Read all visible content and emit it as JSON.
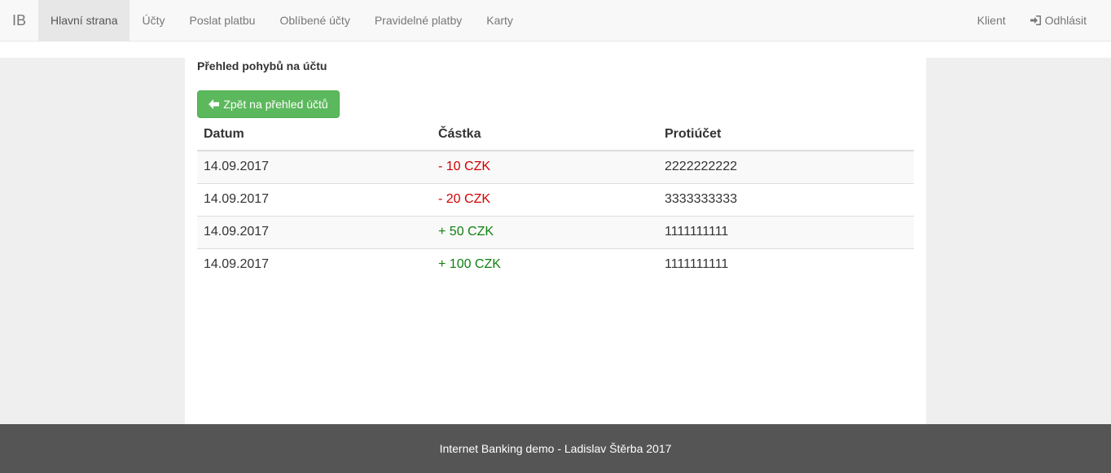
{
  "navbar": {
    "brand": "IB",
    "items": [
      {
        "label": "Hlavní strana",
        "active": true
      },
      {
        "label": "Účty"
      },
      {
        "label": "Poslat platbu"
      },
      {
        "label": "Oblíbené účty"
      },
      {
        "label": "Pravidelné platby"
      },
      {
        "label": "Karty"
      }
    ],
    "right": {
      "client": "Klient",
      "logout": "Odhlásit",
      "logout_icon": "log-in-icon"
    }
  },
  "main": {
    "heading": "Přehled pohybů na účtu",
    "back_button": "Zpět na přehled účtů",
    "back_icon": "arrow-left-icon",
    "table": {
      "headers": [
        "Datum",
        "Částka",
        "Protiúčet"
      ],
      "rows": [
        {
          "date": "14.09.2017",
          "amount": "- 10 CZK",
          "account": "2222222222",
          "direction": "out"
        },
        {
          "date": "14.09.2017",
          "amount": "- 20 CZK",
          "account": "3333333333",
          "direction": "out"
        },
        {
          "date": "14.09.2017",
          "amount": "+ 50 CZK",
          "account": "1111111111",
          "direction": "in"
        },
        {
          "date": "14.09.2017",
          "amount": "+ 100 CZK",
          "account": "1111111111",
          "direction": "in"
        }
      ]
    },
    "colors": {
      "negative": "#d00000",
      "positive": "#108010",
      "button": "#5cb85c"
    }
  },
  "footer": {
    "text": "Internet Banking demo - Ladislav Štěrba 2017"
  }
}
